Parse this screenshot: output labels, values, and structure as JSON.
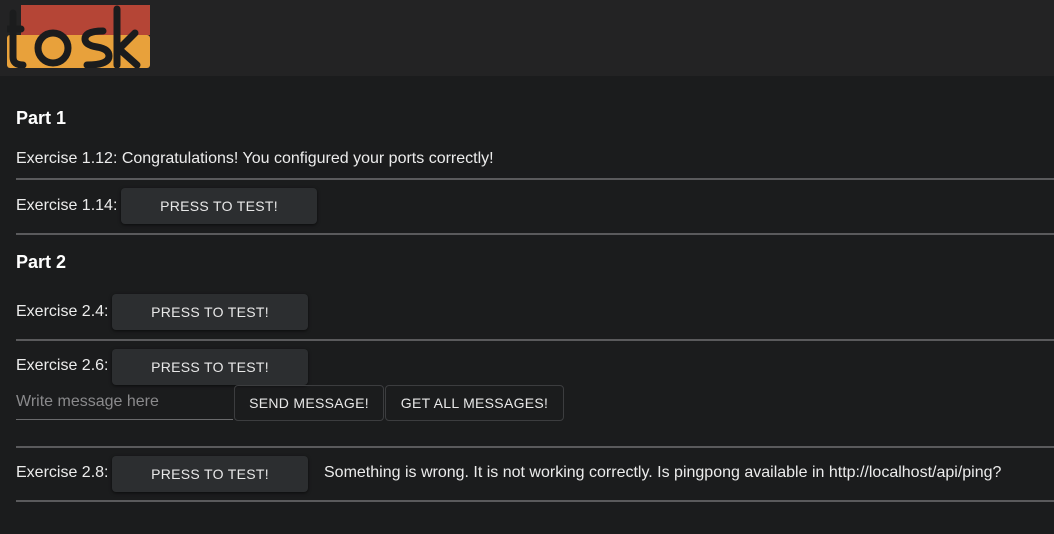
{
  "header": {
    "logo_text": "toska",
    "colors": {
      "top": "#b54536",
      "bottom": "#e8a13b",
      "ink": "#1b1c1d"
    }
  },
  "part1": {
    "title": "Part 1",
    "ex112": "Exercise 1.12: Congratulations! You configured your ports correctly!",
    "ex114_label": "Exercise 1.14:",
    "ex114_button": "PRESS TO TEST!"
  },
  "part2": {
    "title": "Part 2",
    "ex24_label": "Exercise 2.4:",
    "ex24_button": "PRESS TO TEST!",
    "ex26_label": "Exercise 2.6:",
    "ex26_button": "PRESS TO TEST!",
    "message_placeholder": "Write message here",
    "send_button": "SEND MESSAGE!",
    "get_all_button": "GET ALL MESSAGES!",
    "ex28_label": "Exercise 2.8:",
    "ex28_button": "PRESS TO TEST!",
    "ex28_status": "Something is wrong. It is not working correctly. Is pingpong available in http://localhost/api/ping?"
  }
}
